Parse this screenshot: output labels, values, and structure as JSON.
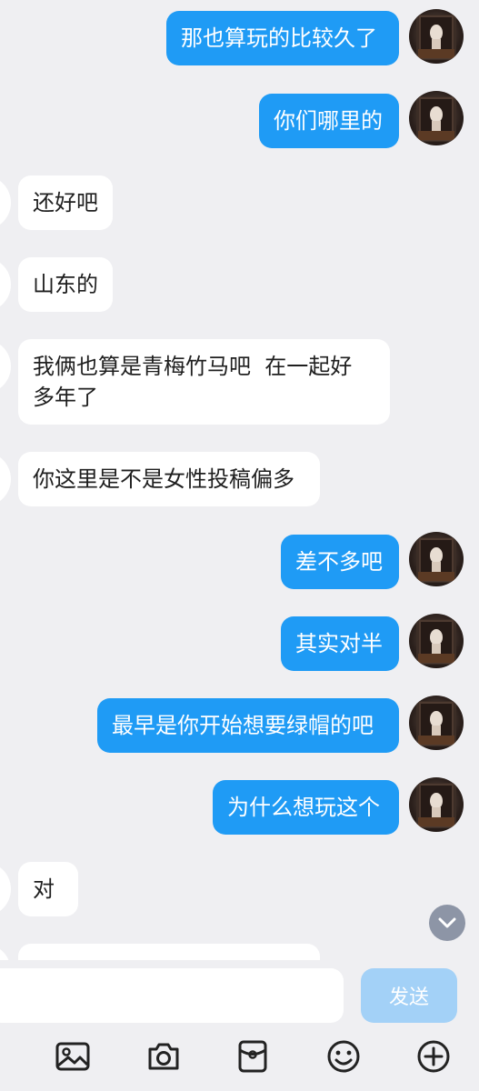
{
  "messages": [
    {
      "side": "out",
      "text": "那也算玩的比较久了"
    },
    {
      "side": "out",
      "text": "你们哪里的"
    },
    {
      "side": "in",
      "text": "还好吧"
    },
    {
      "side": "in",
      "text": "山东的"
    },
    {
      "side": "in",
      "text": "我俩也算是青梅竹马吧  在一起好\n多年了"
    },
    {
      "side": "in",
      "text": "你这里是不是女性投稿偏多"
    },
    {
      "side": "out",
      "text": "差不多吧"
    },
    {
      "side": "out",
      "text": "其实对半"
    },
    {
      "side": "out",
      "text": "最早是你开始想要绿帽的吧"
    },
    {
      "side": "out",
      "text": "为什么想玩这个"
    },
    {
      "side": "in",
      "text": "对"
    },
    {
      "side": "in",
      "text": ""
    }
  ],
  "composer": {
    "input_value": "",
    "input_placeholder": "",
    "send_label": "发送"
  },
  "toolbar": {
    "icons": [
      "image-icon",
      "camera-icon",
      "red-packet-icon",
      "emoji-icon",
      "plus-icon"
    ]
  },
  "colors": {
    "outgoing_bubble": "#1f9bf5",
    "incoming_bubble": "#ffffff",
    "background": "#efeff2",
    "send_button": "#a3d1f7"
  }
}
